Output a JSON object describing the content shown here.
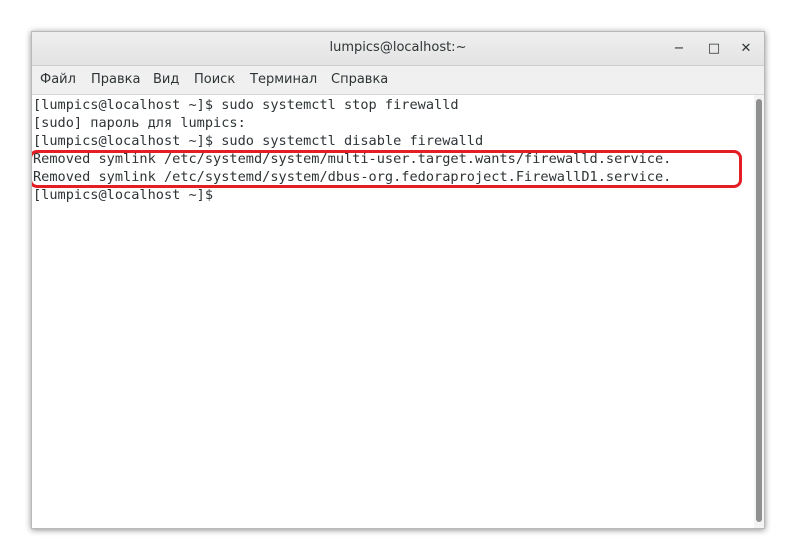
{
  "window": {
    "title": "lumpics@localhost:~",
    "minimize_symbol": "−",
    "maximize_symbol": "□",
    "close_symbol": "✕"
  },
  "menu": {
    "items": [
      "Файл",
      "Правка",
      "Вид",
      "Поиск",
      "Терминал",
      "Справка"
    ]
  },
  "terminal": {
    "lines": [
      "[lumpics@localhost ~]$ sudo systemctl stop firewalld",
      "[sudo] пароль для lumpics:",
      "[lumpics@localhost ~]$ sudo systemctl disable firewalld",
      "Removed symlink /etc/systemd/system/multi-user.target.wants/firewalld.service.",
      "Removed symlink /etc/systemd/system/dbus-org.fedoraproject.FirewallD1.service.",
      "[lumpics@localhost ~]$"
    ]
  },
  "colors": {
    "highlight": "#e31e24",
    "text": "#2e3436"
  },
  "icons": {
    "minimize": "minimize-icon",
    "maximize": "maximize-icon",
    "close": "close-icon"
  }
}
